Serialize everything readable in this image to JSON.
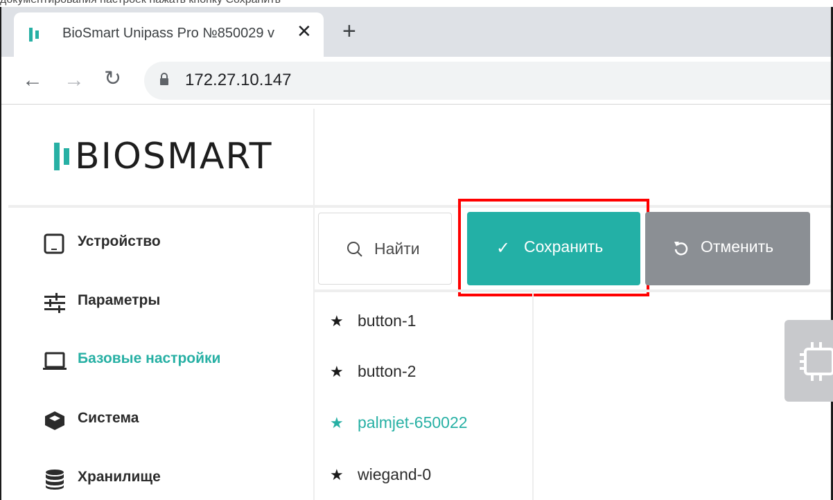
{
  "browser": {
    "tab": {
      "title": "BioSmart Unipass Pro №850029 v"
    },
    "toolbar": {
      "url": "172.27.10.147"
    },
    "brand_color": "#27b0a4"
  },
  "top_strip": {
    "text_partial": "документирования настроек нажать кнопку Сохранить"
  },
  "logo": {
    "text": "BIOSMART"
  },
  "sidebar": {
    "items": [
      {
        "label": "Устройство",
        "icon": "tablet-icon"
      },
      {
        "label": "Параметры",
        "icon": "sliders-icon"
      },
      {
        "label": "Базовые настройки",
        "icon": "laptop-icon",
        "active": true
      },
      {
        "label": "Система",
        "icon": "cube-icon"
      },
      {
        "label": "Хранилище",
        "icon": "database-icon"
      }
    ]
  },
  "actions": {
    "search_label": "Найти",
    "save_label": "Сохранить",
    "cancel_label": "Отменить",
    "save_color": "#23b0a6",
    "cancel_color": "#8b8f94",
    "highlight_color": "#ff0000"
  },
  "devices": {
    "items": [
      {
        "label": "button-1"
      },
      {
        "label": "button-2"
      },
      {
        "label": "palmjet-650022",
        "active": true
      },
      {
        "label": "wiegand-0"
      }
    ]
  }
}
